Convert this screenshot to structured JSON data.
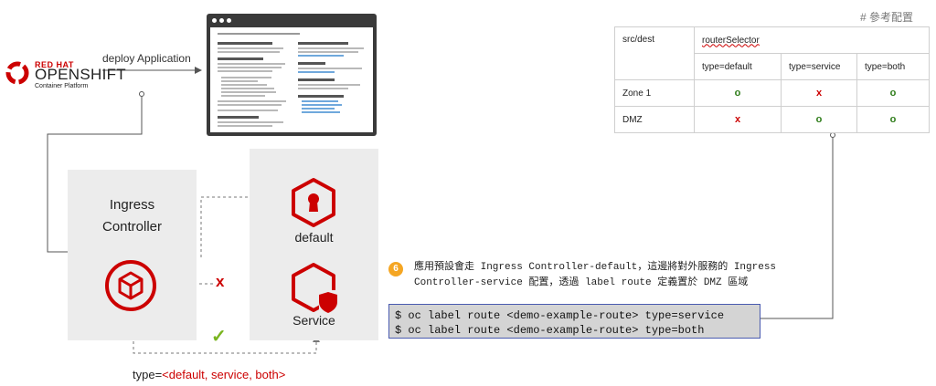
{
  "logo": {
    "brand_top": "RED HAT",
    "brand_main": "OPENSHIFT",
    "brand_sub": "Container Platform"
  },
  "deploy_label": "deploy Application",
  "ingress": {
    "title_line1": "Ingress",
    "title_line2": "Controller"
  },
  "routes": {
    "default_label": "default",
    "service_label": "Service"
  },
  "blocked_mark": "x",
  "allowed_mark": "✓",
  "type_label": {
    "prefix": "type=",
    "values": "<default, service, both>"
  },
  "reference": {
    "title": "# 參考配置",
    "col_src": "src/dest",
    "col_selector": "routerSelector",
    "sub_headers": [
      "type=default",
      "type=service",
      "type=both"
    ],
    "rows": [
      {
        "name": "Zone 1",
        "cells": [
          "o",
          "x",
          "o"
        ]
      },
      {
        "name": "DMZ",
        "cells": [
          "x",
          "o",
          "o"
        ]
      }
    ]
  },
  "note": {
    "step": "6",
    "line1": "應用預設會走 Ingress Controller-default，這邊將對外服務的 Ingress",
    "line2": "Controller-service 配置，透過 label route 定義置於 DMZ 區域"
  },
  "commands": [
    "$ oc label route <demo-example-route> type=service",
    "$ oc label route <demo-example-route> type=both"
  ],
  "colors": {
    "accent_red": "#cc0000",
    "panel_gray": "#ececec",
    "check_green": "#7ab520",
    "step_orange": "#f5a623",
    "cmd_border": "#4a5bb0"
  }
}
